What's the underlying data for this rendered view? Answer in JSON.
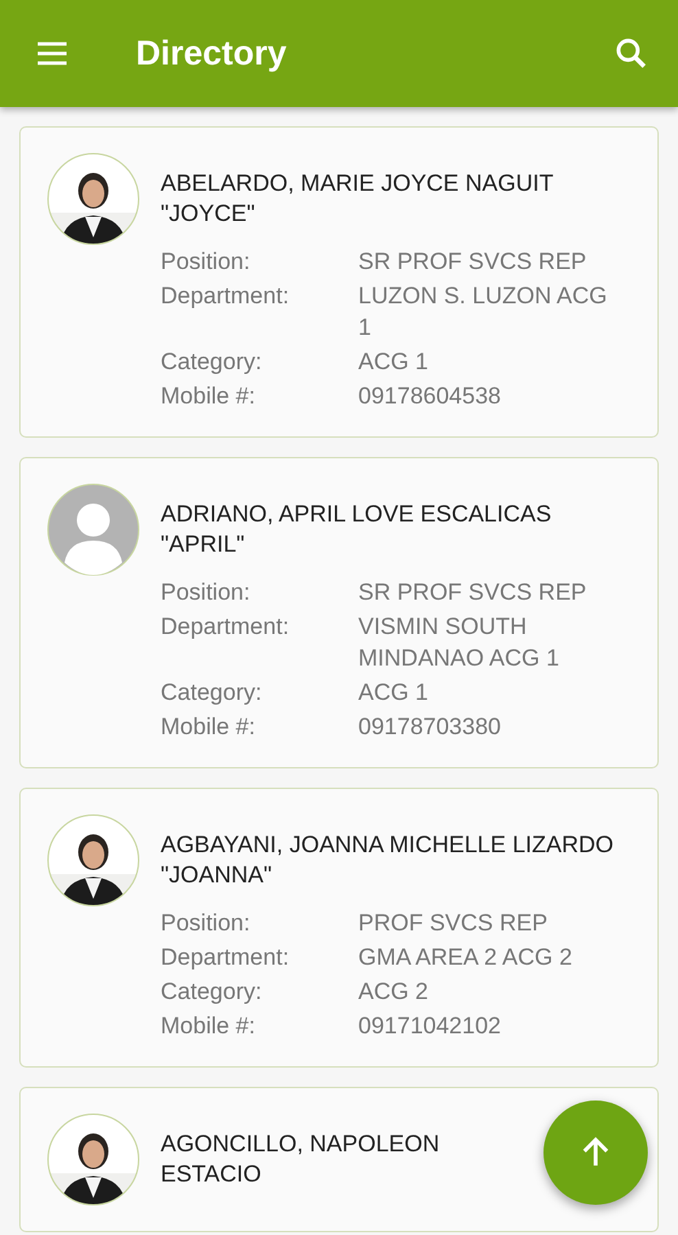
{
  "app_bar": {
    "title": "Directory"
  },
  "contacts": [
    {
      "name": "ABELARDO, MARIE JOYCE NAGUIT",
      "nickname": "\"JOYCE\"",
      "fields": [
        {
          "label": "Position:",
          "value": "SR PROF SVCS REP"
        },
        {
          "label": "Department:",
          "value": "LUZON S. LUZON ACG 1"
        },
        {
          "label": "Category:",
          "value": "ACG 1"
        },
        {
          "label": "Mobile #:",
          "value": "09178604538"
        }
      ]
    },
    {
      "kind": "placeholder",
      "name": "ADRIANO, APRIL LOVE ESCALICAS",
      "nickname": "\"APRIL\"",
      "fields": [
        {
          "label": "Position:",
          "value": "SR PROF SVCS REP"
        },
        {
          "label": "Department:",
          "value": "VISMIN SOUTH MINDANAO ACG 1"
        },
        {
          "label": "Category:",
          "value": "ACG 1"
        },
        {
          "label": "Mobile #:",
          "value": "09178703380"
        }
      ]
    },
    {
      "name": "AGBAYANI, JOANNA MICHELLE LIZARDO",
      "nickname": "\"JOANNA\"",
      "fields": [
        {
          "label": "Position:",
          "value": "PROF SVCS REP"
        },
        {
          "label": "Department:",
          "value": "GMA AREA 2 ACG 2"
        },
        {
          "label": "Category:",
          "value": "ACG 2"
        },
        {
          "label": "Mobile #:",
          "value": "09171042102"
        }
      ]
    },
    {
      "name": "AGONCILLO, NAPOLEON ESTACIO"
    }
  ]
}
